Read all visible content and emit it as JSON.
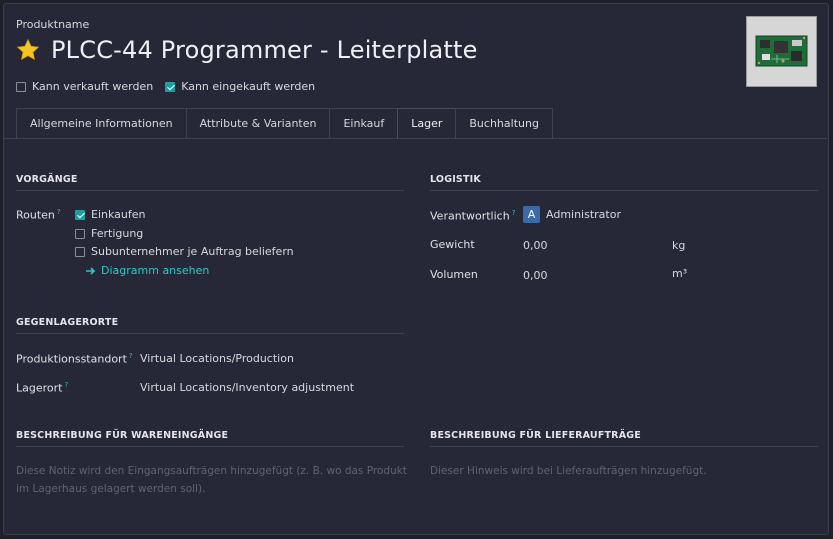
{
  "header": {
    "product_label": "Produktname",
    "title": "PLCC-44 Programmer - Leiterplatte",
    "can_sell_label": "Kann verkauft werden",
    "can_buy_label": "Kann eingekauft werden",
    "can_sell_checked": false,
    "can_buy_checked": true
  },
  "tabs": [
    {
      "label": "Allgemeine Informationen"
    },
    {
      "label": "Attribute & Varianten"
    },
    {
      "label": "Einkauf"
    },
    {
      "label": "Lager"
    },
    {
      "label": "Buchhaltung"
    }
  ],
  "operations": {
    "title": "VORGÄNGE",
    "routes_label": "Routen",
    "help": "?",
    "routes": [
      {
        "label": "Einkaufen",
        "checked": true
      },
      {
        "label": "Fertigung",
        "checked": false
      },
      {
        "label": "Subunternehmer je Auftrag beliefern",
        "checked": false
      }
    ],
    "diagram_link": "Diagramm ansehen"
  },
  "logistics": {
    "title": "LOGISTIK",
    "responsible_label": "Verantwortlich",
    "responsible_initial": "A",
    "responsible_value": "Administrator",
    "weight_label": "Gewicht",
    "weight_value": "0,00",
    "weight_unit": "kg",
    "volume_label": "Volumen",
    "volume_value": "0,00",
    "volume_unit": "m³"
  },
  "counterpart": {
    "title": "GEGENLAGERORTE",
    "production_label": "Produktionsstandort",
    "production_value": "Virtual Locations/Production",
    "inventory_label": "Lagerort",
    "inventory_value": "Virtual Locations/Inventory adjustment"
  },
  "receipts": {
    "title": "BESCHREIBUNG FÜR WARENEINGÄNGE",
    "placeholder_line1": "Diese Notiz wird den Eingangsaufträgen hinzugefügt (z. B. wo das Produkt",
    "placeholder_line2": "im Lagerhaus gelagert werden soll)."
  },
  "deliveries": {
    "title": "BESCHREIBUNG FÜR LIEFERAUFTRÄGE",
    "placeholder": "Dieser Hinweis wird bei Lieferaufträgen hinzugefügt."
  },
  "colors": {
    "accent": "#1aa0a0",
    "link": "#2fc6c6",
    "background": "#262837",
    "star": "#f3c623",
    "avatar": "#3b6aa6"
  }
}
